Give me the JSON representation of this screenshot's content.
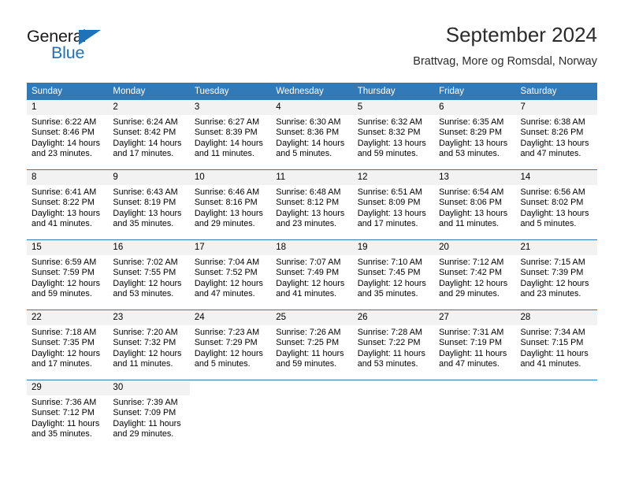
{
  "logo": {
    "word_top": "General",
    "word_bottom": "Blue",
    "triangle_color": "#1f71b8",
    "text_color": "#1a1a1a"
  },
  "header": {
    "title": "September 2024",
    "subtitle": "Brattvag, More og Romsdal, Norway"
  },
  "colors": {
    "header_blue": "#3279b7",
    "daynum_background": "#f2f2f2",
    "text": "#000000"
  },
  "calendar": {
    "weekday_headers": [
      "Sunday",
      "Monday",
      "Tuesday",
      "Wednesday",
      "Thursday",
      "Friday",
      "Saturday"
    ],
    "weeks": [
      [
        {
          "day": "1",
          "details": "Sunrise: 6:22 AM\nSunset: 8:46 PM\nDaylight: 14 hours\nand 23 minutes."
        },
        {
          "day": "2",
          "details": "Sunrise: 6:24 AM\nSunset: 8:42 PM\nDaylight: 14 hours\nand 17 minutes."
        },
        {
          "day": "3",
          "details": "Sunrise: 6:27 AM\nSunset: 8:39 PM\nDaylight: 14 hours\nand 11 minutes."
        },
        {
          "day": "4",
          "details": "Sunrise: 6:30 AM\nSunset: 8:36 PM\nDaylight: 14 hours\nand 5 minutes."
        },
        {
          "day": "5",
          "details": "Sunrise: 6:32 AM\nSunset: 8:32 PM\nDaylight: 13 hours\nand 59 minutes."
        },
        {
          "day": "6",
          "details": "Sunrise: 6:35 AM\nSunset: 8:29 PM\nDaylight: 13 hours\nand 53 minutes."
        },
        {
          "day": "7",
          "details": "Sunrise: 6:38 AM\nSunset: 8:26 PM\nDaylight: 13 hours\nand 47 minutes."
        }
      ],
      [
        {
          "day": "8",
          "details": "Sunrise: 6:41 AM\nSunset: 8:22 PM\nDaylight: 13 hours\nand 41 minutes."
        },
        {
          "day": "9",
          "details": "Sunrise: 6:43 AM\nSunset: 8:19 PM\nDaylight: 13 hours\nand 35 minutes."
        },
        {
          "day": "10",
          "details": "Sunrise: 6:46 AM\nSunset: 8:16 PM\nDaylight: 13 hours\nand 29 minutes."
        },
        {
          "day": "11",
          "details": "Sunrise: 6:48 AM\nSunset: 8:12 PM\nDaylight: 13 hours\nand 23 minutes."
        },
        {
          "day": "12",
          "details": "Sunrise: 6:51 AM\nSunset: 8:09 PM\nDaylight: 13 hours\nand 17 minutes."
        },
        {
          "day": "13",
          "details": "Sunrise: 6:54 AM\nSunset: 8:06 PM\nDaylight: 13 hours\nand 11 minutes."
        },
        {
          "day": "14",
          "details": "Sunrise: 6:56 AM\nSunset: 8:02 PM\nDaylight: 13 hours\nand 5 minutes."
        }
      ],
      [
        {
          "day": "15",
          "details": "Sunrise: 6:59 AM\nSunset: 7:59 PM\nDaylight: 12 hours\nand 59 minutes."
        },
        {
          "day": "16",
          "details": "Sunrise: 7:02 AM\nSunset: 7:55 PM\nDaylight: 12 hours\nand 53 minutes."
        },
        {
          "day": "17",
          "details": "Sunrise: 7:04 AM\nSunset: 7:52 PM\nDaylight: 12 hours\nand 47 minutes."
        },
        {
          "day": "18",
          "details": "Sunrise: 7:07 AM\nSunset: 7:49 PM\nDaylight: 12 hours\nand 41 minutes."
        },
        {
          "day": "19",
          "details": "Sunrise: 7:10 AM\nSunset: 7:45 PM\nDaylight: 12 hours\nand 35 minutes."
        },
        {
          "day": "20",
          "details": "Sunrise: 7:12 AM\nSunset: 7:42 PM\nDaylight: 12 hours\nand 29 minutes."
        },
        {
          "day": "21",
          "details": "Sunrise: 7:15 AM\nSunset: 7:39 PM\nDaylight: 12 hours\nand 23 minutes."
        }
      ],
      [
        {
          "day": "22",
          "details": "Sunrise: 7:18 AM\nSunset: 7:35 PM\nDaylight: 12 hours\nand 17 minutes."
        },
        {
          "day": "23",
          "details": "Sunrise: 7:20 AM\nSunset: 7:32 PM\nDaylight: 12 hours\nand 11 minutes."
        },
        {
          "day": "24",
          "details": "Sunrise: 7:23 AM\nSunset: 7:29 PM\nDaylight: 12 hours\nand 5 minutes."
        },
        {
          "day": "25",
          "details": "Sunrise: 7:26 AM\nSunset: 7:25 PM\nDaylight: 11 hours\nand 59 minutes."
        },
        {
          "day": "26",
          "details": "Sunrise: 7:28 AM\nSunset: 7:22 PM\nDaylight: 11 hours\nand 53 minutes."
        },
        {
          "day": "27",
          "details": "Sunrise: 7:31 AM\nSunset: 7:19 PM\nDaylight: 11 hours\nand 47 minutes."
        },
        {
          "day": "28",
          "details": "Sunrise: 7:34 AM\nSunset: 7:15 PM\nDaylight: 11 hours\nand 41 minutes."
        }
      ],
      [
        {
          "day": "29",
          "details": "Sunrise: 7:36 AM\nSunset: 7:12 PM\nDaylight: 11 hours\nand 35 minutes."
        },
        {
          "day": "30",
          "details": "Sunrise: 7:39 AM\nSunset: 7:09 PM\nDaylight: 11 hours\nand 29 minutes."
        },
        {
          "day": "",
          "details": ""
        },
        {
          "day": "",
          "details": ""
        },
        {
          "day": "",
          "details": ""
        },
        {
          "day": "",
          "details": ""
        },
        {
          "day": "",
          "details": ""
        }
      ]
    ]
  }
}
